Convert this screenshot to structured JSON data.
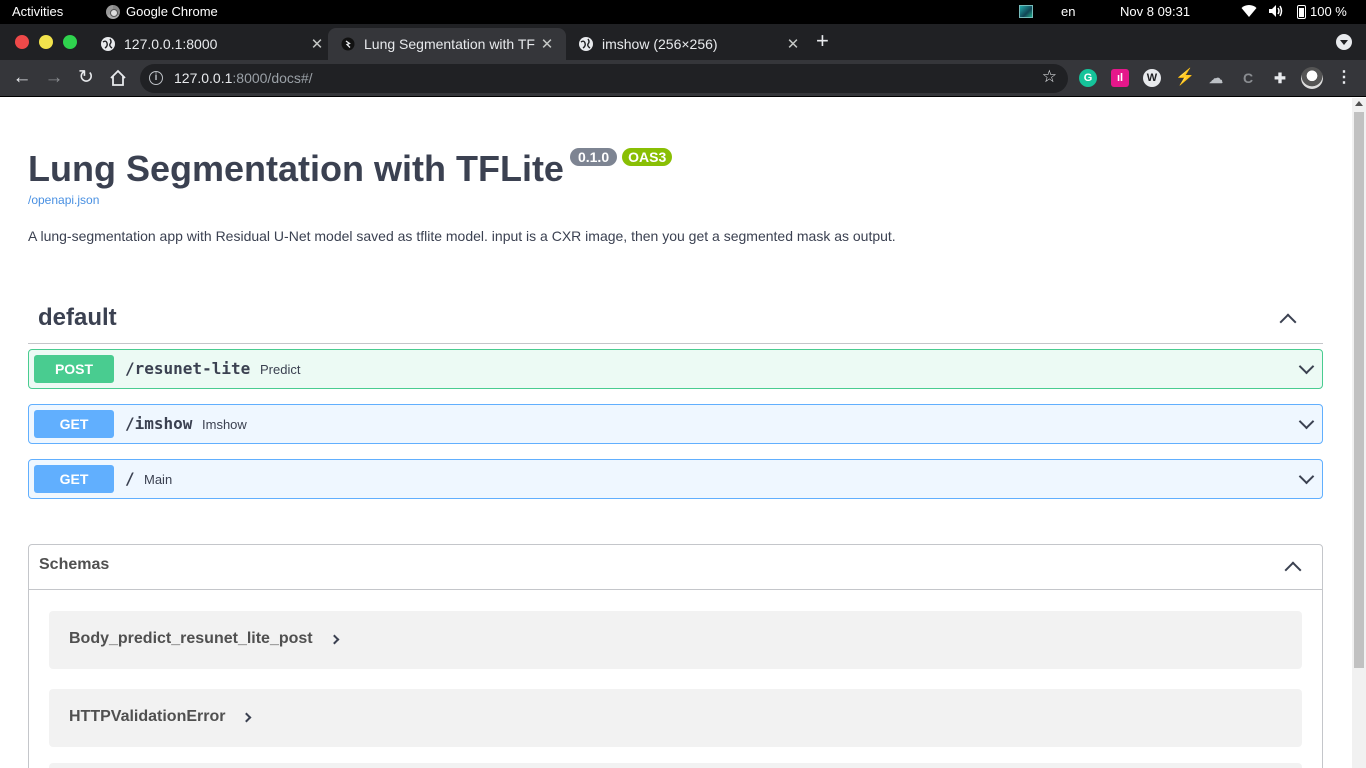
{
  "system_bar": {
    "activities": "Activities",
    "app_name": "Google Chrome",
    "language": "en",
    "clock": "Nov 8  09:31",
    "battery": "100 %"
  },
  "tabs": [
    {
      "title": "127.0.0.1:8000",
      "active": false
    },
    {
      "title": "Lung Segmentation with TFLite - Swagger UI",
      "active": true
    },
    {
      "title": "imshow (256×256)",
      "active": false
    }
  ],
  "address_bar": {
    "host": "127.0.0.1",
    "path": ":8000/docs#/"
  },
  "page": {
    "title": "Lung Segmentation with TFLite",
    "version": "0.1.0",
    "oas_badge": "OAS3",
    "spec_link": "/openapi.json",
    "description": "A lung-segmentation app with Residual U-Net model saved as tflite model. input is a CXR image, then you get a segmented mask as output.",
    "tag": "default",
    "operations": [
      {
        "method": "POST",
        "path": "/resunet-lite",
        "summary": "Predict"
      },
      {
        "method": "GET",
        "path": "/imshow",
        "summary": "Imshow"
      },
      {
        "method": "GET",
        "path": "/",
        "summary": "Main"
      }
    ],
    "schemas_label": "Schemas",
    "schemas": [
      "Body_predict_resunet_lite_post",
      "HTTPValidationError"
    ]
  },
  "colors": {
    "post": "#49cc90",
    "get": "#61affe",
    "oas": "#89bf04",
    "version": "#7d8492",
    "text": "#3b4151"
  }
}
